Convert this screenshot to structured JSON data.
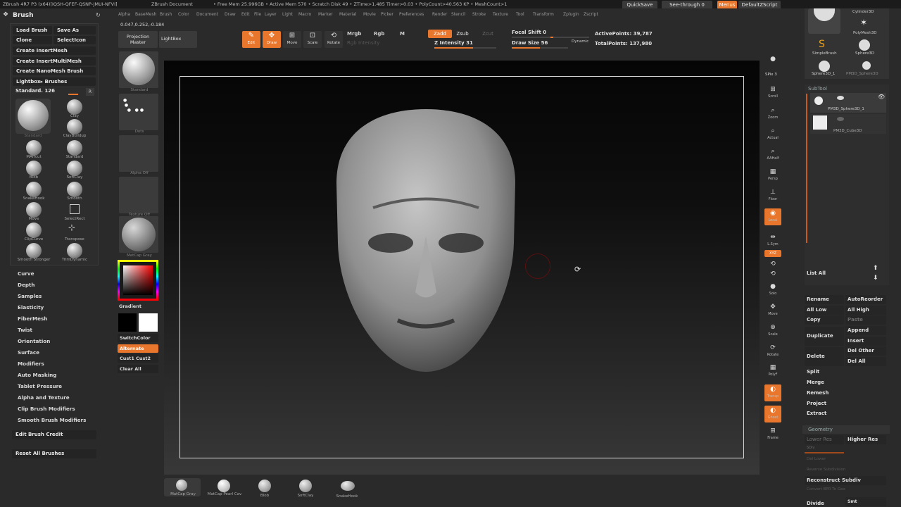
{
  "titlebar": {
    "app": "ZBrush 4R7 P3 (x64)[IQSH-QFEF-QSNP-JMUI-NFVI]",
    "doc": "ZBrush Document",
    "freemem": "• Free Mem 25.996GB • Active Mem 570 • Scratch Disk 49 • ZTime>1.485 Timer>0.03 • PolyCount>40.563 KP • MeshCount>1",
    "quicksave": "QuickSave",
    "seethrough": "See-through  0",
    "menus": "Menus",
    "script": "DefaultZScript"
  },
  "menubar": [
    "Alpha",
    "BaseMesh",
    "Brush",
    "Color",
    "Document",
    "Draw",
    "Edit",
    "File",
    "Layer",
    "Light",
    "Macro",
    "Marker",
    "Material",
    "Movie",
    "Picker",
    "Preferences",
    "Render",
    "Stencil",
    "Stroke",
    "Texture",
    "Tool",
    "Transform",
    "Zplugin",
    "Zscript"
  ],
  "coords": "0.047,0.252,-0.184",
  "brushpanel": {
    "title": "Brush",
    "load": "Load Brush",
    "save": "Save As",
    "clone": "Clone",
    "selecticon": "SelectIcon",
    "insertmesh": "Create InsertMesh",
    "insertmulti": "Create InsertMultiMesh",
    "nanomesh": "Create NanoMesh Brush",
    "lightbox": "Lightbox▸ Brushes",
    "current": "Standard. 126",
    "r": "R",
    "big_label": "Standard",
    "brushes": [
      "Clay",
      "ClayBuildup",
      "MAHcut",
      "Standard",
      "Blob",
      "SoftClay",
      "SnakeHook",
      "Smooth",
      "Move",
      "SelectRect",
      "ClipCurve",
      "Transpose",
      "Smooth Stronger",
      "TrimDynamic"
    ]
  },
  "brushmenu": [
    "Curve",
    "Depth",
    "Samples",
    "Elasticity",
    "FiberMesh",
    "Twist",
    "Orientation",
    "Surface",
    "Modifiers",
    "Auto Masking",
    "Tablet Pressure",
    "Alpha and Texture",
    "Clip Brush Modifiers",
    "Smooth Brush Modifiers"
  ],
  "editcredit": "Edit Brush Credit",
  "resetbrushes": "Reset All Brushes",
  "col2": {
    "projection": "Projection Master",
    "lightbox": "LightBox",
    "labels": [
      "Standard",
      "Dots",
      "Alpha  Off",
      "Texture  Off",
      "MatCap  Gray"
    ],
    "gradient": "Gradient",
    "switchcolor": "SwitchColor",
    "alternate": "Alternate",
    "cust": "Cust1  Cust2",
    "clearall": "Clear All"
  },
  "toolbar": {
    "edit": "Edit",
    "draw": "Draw",
    "move": "Move",
    "scale": "Scale",
    "rotate": "Rotate",
    "mrgb": "Mrgb",
    "rgb": "Rgb",
    "m": "M",
    "rgbint": "Rgb  Intensity",
    "zadd": "Zadd",
    "zsub": "Zsub",
    "zcut": "Zcut",
    "zint": "Z Intensity 31",
    "focal": "Focal Shift 0",
    "drawsize": "Draw Size 56",
    "dynamic": "Dynamic",
    "activepoints": "ActivePoints: 39,787",
    "totalpoints": "TotalPoints: 137,980"
  },
  "righttools": [
    "SPix 3",
    "Scroll",
    "Zoom",
    "Actual",
    "AAHalf",
    "Persp",
    "Floor",
    "Local",
    "L.Sym",
    "XYZ",
    "",
    "",
    "Solo",
    "Move",
    "Scale",
    "Rotate",
    "PolyF",
    "Transp",
    "Ghost",
    "Frame"
  ],
  "tools": {
    "items": [
      "Cylinder3D",
      "PolyMesh3D",
      "SimpleBrush",
      "Sphere3D",
      "Sphere3D_1",
      "PM3D_Sphere3D"
    ],
    "subtool": "SubTool",
    "sub1": "PM3D_Sphere3D_1",
    "sub2": "PM3D_Cube3D",
    "listall": "List  All",
    "rename": "Rename",
    "autoreorder": "AutoReorder",
    "alllow": "All Low",
    "allhigh": "All High",
    "copy": "Copy",
    "paste": "Paste",
    "duplicate": "Duplicate",
    "append": "Append",
    "insert": "Insert",
    "delete": "Delete",
    "delother": "Del Other",
    "delall": "Del All",
    "split": "Split",
    "merge": "Merge",
    "remesh": "Remesh",
    "project": "Project",
    "extract": "Extract",
    "geometry": "Geometry",
    "lowerres": "Lower Res",
    "higherres": "Higher Res",
    "sdiv": "SDiv",
    "dellower": "Del Lower",
    "reverse": "Reverse Subdivision",
    "reconstruct": "Reconstruct Subdiv",
    "convert": "Convert BPR To Geo",
    "divide": "Divide",
    "smt": "Smt"
  },
  "shelf": [
    "MatCap Gray",
    "MatCap Pearl Cav",
    "Blob",
    "SoftClay",
    "SnakeHook"
  ]
}
